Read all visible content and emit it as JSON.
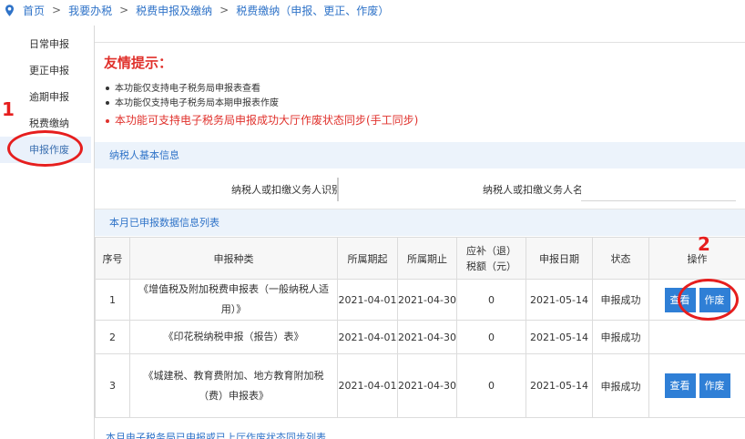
{
  "breadcrumb": {
    "items": [
      "首页",
      "我要办税",
      "税费申报及缴纳",
      "税费缴纳（申报、更正、作废）"
    ],
    "separator": ">"
  },
  "sidebar": {
    "items": [
      {
        "label": "日常申报"
      },
      {
        "label": "更正申报"
      },
      {
        "label": "逾期申报"
      },
      {
        "label": "税费缴纳"
      },
      {
        "label": "申报作废",
        "active": true
      }
    ]
  },
  "tips": {
    "title": "友情提示：",
    "lines": [
      "本功能仅支持电子税务局申报表查看",
      "本功能仅支持电子税务局本期申报表作废",
      "本功能可支持电子税务局申报成功大厅作废状态同步(手工同步)"
    ]
  },
  "taxpayer_section": {
    "title": "纳税人基本信息",
    "id_label": "纳税人或扣缴义务人识别号",
    "id_value": "",
    "name_label": "纳税人或扣缴义务人名称",
    "name_value": ""
  },
  "list_section": {
    "title": "本月已申报数据信息列表",
    "columns": [
      "序号",
      "申报种类",
      "所属期起",
      "所属期止",
      "应补（退）税额（元）",
      "申报日期",
      "状态",
      "操作"
    ],
    "rows": [
      {
        "no": "1",
        "type": "《增值税及附加税费申报表（一般纳税人适用）》",
        "start": "2021-04-01",
        "end": "2021-04-30",
        "amount": "0",
        "date": "2021-05-14",
        "status": "申报成功",
        "actions": [
          "查看",
          "作废"
        ]
      },
      {
        "no": "2",
        "type": "《印花税纳税申报（报告）表》",
        "start": "2021-04-01",
        "end": "2021-04-30",
        "amount": "0",
        "date": "2021-05-14",
        "status": "申报成功",
        "actions": []
      },
      {
        "no": "3",
        "type": "《城建税、教育费附加、地方教育附加税（费）申报表》",
        "start": "2021-04-01",
        "end": "2021-04-30",
        "amount": "0",
        "date": "2021-05-14",
        "status": "申报成功",
        "actions": [
          "查看",
          "作废"
        ]
      }
    ]
  },
  "footer_partial": "本月电子税务局已申报或已上厅作废状态同步列表",
  "annotations": {
    "mark1": "1",
    "mark2": "2",
    "color": "#e61e1e"
  },
  "colors": {
    "accent": "#2f7fd6",
    "link": "#2f73c8",
    "warning": "#e0312c",
    "section_bg": "#ecf3fb"
  },
  "icons": {
    "breadcrumb_marker": "location-pin-icon"
  }
}
